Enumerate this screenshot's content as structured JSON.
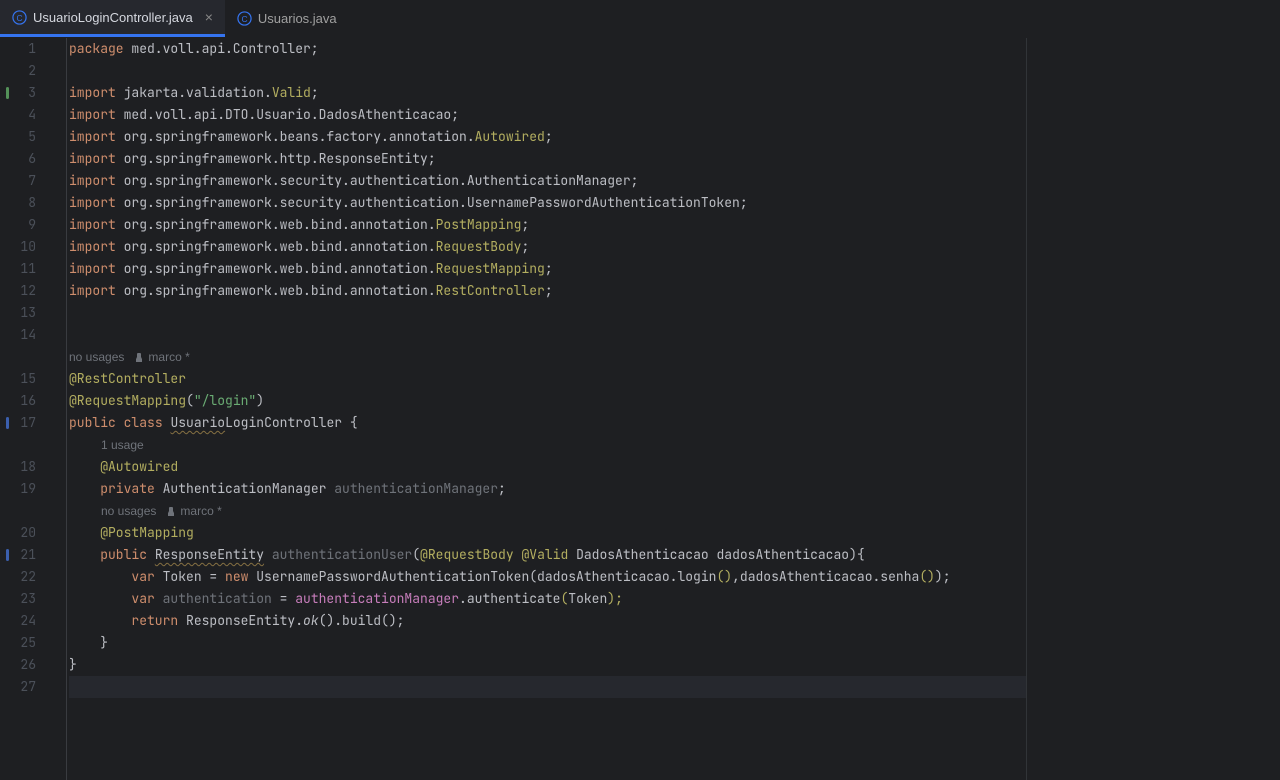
{
  "tabs": [
    {
      "name": "UsuarioLoginController.java",
      "active": true
    },
    {
      "name": "Usuarios.java",
      "active": false
    }
  ],
  "hints": {
    "no_usages": "no usages",
    "one_usage": "1 usage",
    "author": "marco *"
  },
  "code": {
    "l1": {
      "kw": "package",
      "rest": " med.voll.api.Controller;"
    },
    "l3": {
      "kw": "import",
      "pre": " jakarta.validation.",
      "cls": "Valid",
      "post": ";"
    },
    "l4": {
      "kw": "import",
      "rest": " med.voll.api.DTO.Usuario.DadosAthenticacao;"
    },
    "l5": {
      "kw": "import",
      "pre": " org.springframework.beans.factory.annotation.",
      "cls": "Autowired",
      "post": ";"
    },
    "l6": {
      "kw": "import",
      "rest": " org.springframework.http.ResponseEntity;"
    },
    "l7": {
      "kw": "import",
      "rest": " org.springframework.security.authentication.AuthenticationManager;"
    },
    "l8": {
      "kw": "import",
      "rest": " org.springframework.security.authentication.UsernamePasswordAuthenticationToken;"
    },
    "l9": {
      "kw": "import",
      "pre": " org.springframework.web.bind.annotation.",
      "cls": "PostMapping",
      "post": ";"
    },
    "l10": {
      "kw": "import",
      "pre": " org.springframework.web.bind.annotation.",
      "cls": "RequestBody",
      "post": ";"
    },
    "l11": {
      "kw": "import",
      "pre": " org.springframework.web.bind.annotation.",
      "cls": "RequestMapping",
      "post": ";"
    },
    "l12": {
      "kw": "import",
      "pre": " org.springframework.web.bind.annotation.",
      "cls": "RestController",
      "post": ";"
    },
    "l15": {
      "ann": "@RestController"
    },
    "l16": {
      "ann": "@RequestMapping",
      "open": "(",
      "str": "\"/login\"",
      "close": ")"
    },
    "l17": {
      "kw1": "public",
      "kw2": "class",
      "warn": "Usuario",
      "cls": "LoginController",
      "brace": " {"
    },
    "l18": {
      "indent": "    ",
      "ann": "@Autowired"
    },
    "l19": {
      "indent": "    ",
      "kw": "private",
      "type": " AuthenticationManager ",
      "fld": "authenticationManager",
      "semi": ";"
    },
    "l20": {
      "indent": "    ",
      "ann": "@PostMapping"
    },
    "l21": {
      "indent": "    ",
      "kw": "public",
      "type": "ResponseEntity",
      "mtd": " authenticationUser",
      "open": "(",
      "ann1": "@RequestBody",
      "ann2": "@Valid",
      "ptype": " DadosAthenticacao ",
      "pname": "dadosAthenticacao",
      "close": ")",
      "brace": "{"
    },
    "l22": {
      "indent": "        ",
      "kw": "var",
      "varname": " Token ",
      "eq": "= ",
      "kw2": "new",
      "type": " UsernamePasswordAuthenticationToken(",
      "arg1": "dadosAthenticacao",
      "dot1": ".login",
      "p1": "()",
      "comma": ",",
      "arg2": "dadosAthenticacao",
      "dot2": ".senha",
      "p2": "()",
      "close": ");"
    },
    "l23": {
      "indent": "        ",
      "kw": "var",
      "varname": " authentication ",
      "eq": "= ",
      "fld": "authenticationManager",
      "dot": ".authenticate",
      "open": "(",
      "arg": "Token",
      "close": ");"
    },
    "l24": {
      "indent": "        ",
      "kw": "return",
      "cls": " ResponseEntity.",
      "it": "ok",
      "rest": "().build();"
    },
    "l25": {
      "indent": "    ",
      "brace": "}"
    },
    "l26": {
      "brace": "}"
    }
  },
  "line_numbers": [
    "1",
    "2",
    "3",
    "4",
    "5",
    "6",
    "7",
    "8",
    "9",
    "10",
    "11",
    "12",
    "13",
    "14",
    "",
    "15",
    "16",
    "17",
    "",
    "18",
    "19",
    "",
    "20",
    "21",
    "22",
    "23",
    "24",
    "25",
    "26",
    "27"
  ]
}
